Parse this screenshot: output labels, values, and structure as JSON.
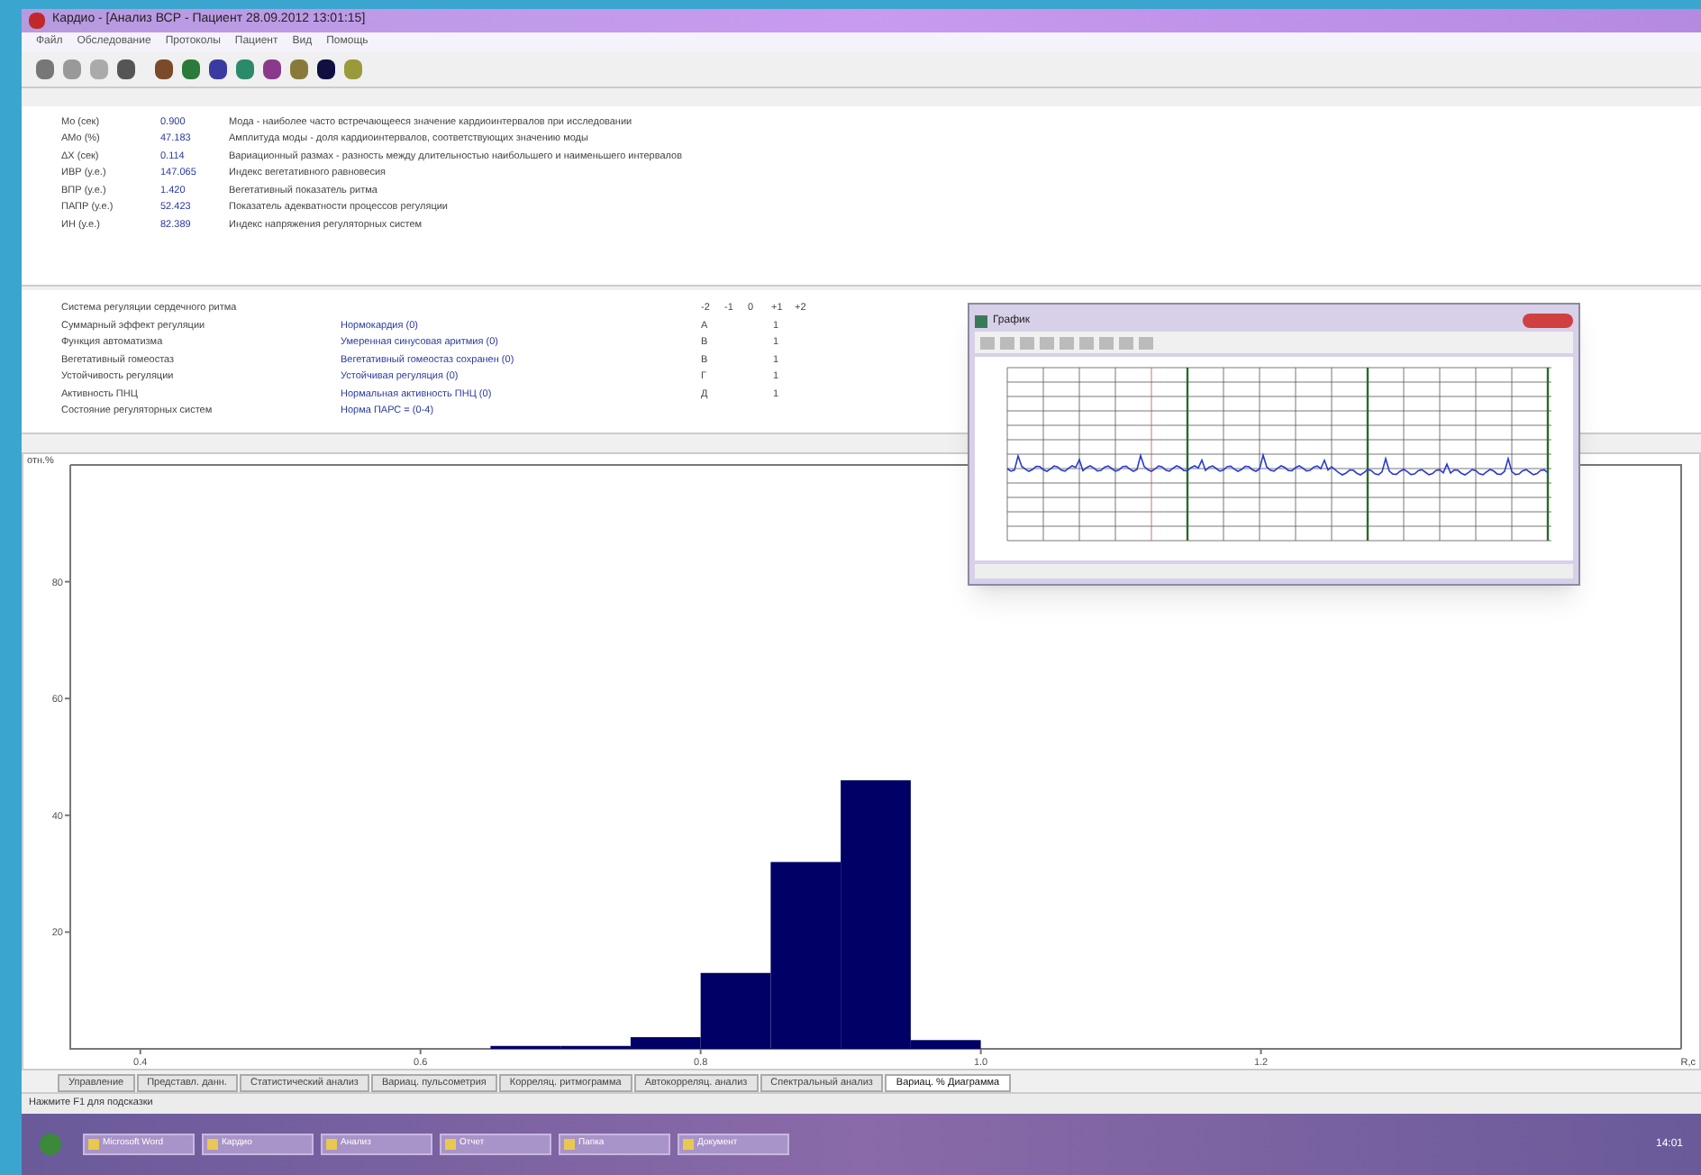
{
  "window": {
    "title": "Кардио - [Анализ ВСР - Пациент 28.09.2012 13:01:15]"
  },
  "menu": [
    "Файл",
    "Обследование",
    "Протоколы",
    "Пациент",
    "Вид",
    "Помощь"
  ],
  "indices": [
    {
      "name": "Mo (сек)",
      "value": "0.900",
      "description": "Мода - наиболее часто встречающееся значение кардиоинтервалов при исследовании"
    },
    {
      "name": "AMo (%)",
      "value": "47.183",
      "description": "Амплитуда моды - доля кардиоинтервалов, соответствующих значению моды"
    },
    {
      "name": "ΔX (сек)",
      "value": "0.114",
      "description": "Вариационный размах - разность между длительностью наибольшего и наименьшего интервалов"
    },
    {
      "name": "ИВР (у.е.)",
      "value": "147.065",
      "description": "Индекс вегетативного равновесия"
    },
    {
      "name": "ВПР (у.е.)",
      "value": "1.420",
      "description": "Вегетативный показатель ритма"
    },
    {
      "name": "ПАПР (у.е.)",
      "value": "52.423",
      "description": "Показатель адекватности процессов регуляции"
    },
    {
      "name": "ИН (у.е.)",
      "value": "82.389",
      "description": "Индекс напряжения регуляторных систем"
    }
  ],
  "regulation": {
    "title": "Система регуляции сердечного ритма",
    "header": [
      "-2",
      "-1",
      "0",
      "+1",
      "+2"
    ],
    "rows": [
      {
        "label": "Суммарный эффект регуляции",
        "assessment": "Нормокардия (0)",
        "letter": "А",
        "score": "1"
      },
      {
        "label": "Функция автоматизма",
        "assessment": "Умеренная синусовая аритмия (0)",
        "letter": "В",
        "score": "1"
      },
      {
        "label": "Вегетативный гомеостаз",
        "assessment": "Вегетативный гомеостаз сохранен (0)",
        "letter": "В",
        "score": "1"
      },
      {
        "label": "Устойчивость регуляции",
        "assessment": "Устойчивая регуляция (0)",
        "letter": "Г",
        "score": "1"
      },
      {
        "label": "Активность ПНЦ",
        "assessment": "Нормальная активность ПНЦ (0)",
        "letter": "Д",
        "score": "1"
      },
      {
        "label": "Состояние регуляторных систем",
        "assessment": "Норма ПАРС = (0-4)"
      }
    ]
  },
  "histogram": {
    "chart_data": {
      "type": "bar",
      "ylabel": "отн.%",
      "xlabel": "R,с",
      "x": [
        0.675,
        0.725,
        0.775,
        0.825,
        0.875,
        0.925,
        0.975
      ],
      "values": [
        0.5,
        0.5,
        2,
        13,
        32,
        46,
        1.5
      ],
      "xlim": [
        0.35,
        1.5
      ],
      "ylim": [
        0,
        100
      ],
      "yticks": [
        20,
        40,
        60,
        80
      ],
      "xticks": [
        {
          "value": 0.4,
          "label": "0.4"
        },
        {
          "value": 0.6,
          "label": "0.6"
        },
        {
          "value": 0.8,
          "label": "0.8"
        },
        {
          "value": 1.0,
          "label": "1.0"
        },
        {
          "value": 1.2,
          "label": "1.2"
        }
      ]
    }
  },
  "graph_window": {
    "title": "График"
  },
  "tabs": [
    {
      "label": "Управление",
      "selected": false
    },
    {
      "label": "Представл. данн.",
      "selected": false
    },
    {
      "label": "Статистический анализ",
      "selected": false
    },
    {
      "label": "Вариац. пульсометрия",
      "selected": false
    },
    {
      "label": "Корреляц. ритмограмма",
      "selected": false
    },
    {
      "label": "Автокорреляц. анализ",
      "selected": false
    },
    {
      "label": "Спектральный анализ",
      "selected": false
    },
    {
      "label": "Вариац. % Диаграмма",
      "selected": true
    }
  ],
  "status_bar": "Нажмите F1 для подсказки",
  "taskbar": {
    "tasks": [
      "Microsoft Word",
      "Кардио",
      "Анализ",
      "Отчет",
      "Папка",
      "Документ"
    ],
    "clock": "14:01"
  }
}
